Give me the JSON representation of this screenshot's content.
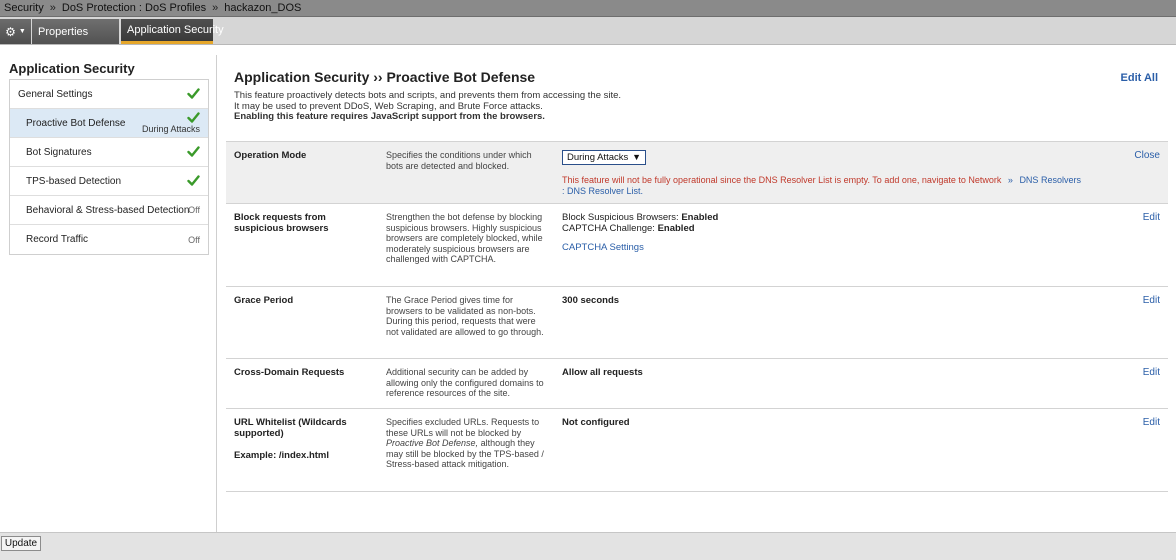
{
  "breadcrumb": {
    "items": [
      "Security",
      "DoS Protection : DoS Profiles",
      "hackazon_DOS"
    ],
    "separator": "»"
  },
  "tabs": {
    "gear_icon": "gear-icon",
    "properties": "Properties",
    "application_security": "Application Security"
  },
  "sidebar": {
    "title": "Application Security",
    "items": [
      {
        "label": "General Settings",
        "status": "",
        "check": true
      },
      {
        "label": "Proactive Bot Defense",
        "status": "During Attacks",
        "check": true
      },
      {
        "label": "Bot Signatures",
        "status": "",
        "check": true
      },
      {
        "label": "TPS-based Detection",
        "status": "",
        "check": true
      },
      {
        "label": "Behavioral & Stress-based Detection",
        "status": "Off",
        "check": false
      },
      {
        "label": "Record Traffic",
        "status": "Off",
        "check": false
      }
    ]
  },
  "main": {
    "title": "Application Security ›› Proactive Bot Defense",
    "edit_all": "Edit All",
    "description": {
      "line1": "This feature proactively detects bots and scripts, and prevents them from accessing the site.",
      "line2": "It may be used to prevent DDoS, Web Scraping, and Brute Force attacks.",
      "line3": "Enabling this feature requires JavaScript support from the browsers."
    },
    "rows": {
      "operation_mode": {
        "label": "Operation Mode",
        "help": "Specifies the conditions under which bots are detected and blocked.",
        "select_value": "During Attacks",
        "warning_text": "This feature will not be fully operational since the DNS Resolver List is empty. To add one, navigate to Network",
        "warning_sep": "»",
        "warning_link1": "DNS Resolvers",
        "warning_link2": ": DNS Resolver List.",
        "action": "Close"
      },
      "block_requests": {
        "label": "Block requests from suspicious browsers",
        "help": "Strengthen the bot defense by blocking suspicious browsers. Highly suspicious browsers are completely blocked, while moderately suspicious browsers are challenged with CAPTCHA.",
        "line1_label": "Block Suspicious Browsers:",
        "line1_value": "Enabled",
        "line2_label": "CAPTCHA Challenge:",
        "line2_value": "Enabled",
        "link": "CAPTCHA Settings",
        "action": "Edit"
      },
      "grace_period": {
        "label": "Grace Period",
        "help": "The Grace Period gives time for browsers to be validated as non-bots. During this period, requests that were not validated are allowed to go through.",
        "value": "300 seconds",
        "action": "Edit"
      },
      "cross_domain": {
        "label": "Cross-Domain Requests",
        "help": "Additional security can be added by allowing only the configured domains to reference resources of the site.",
        "value": "Allow all requests",
        "action": "Edit"
      },
      "url_whitelist": {
        "label": "URL Whitelist (Wildcards supported)",
        "example": "Example: /index.html",
        "help_pre": "Specifies excluded URLs. Requests to these URLs will not be blocked by",
        "help_italic": "Proactive Bot Defense,",
        "help_post": "although they may still be blocked by the TPS-based / Stress-based attack mitigation.",
        "value": "Not configured",
        "action": "Edit"
      }
    }
  },
  "footer": {
    "update_button": "Update"
  },
  "colors": {
    "link": "#2a5ea8",
    "warning": "#c0392b",
    "check": "#3a9a2a",
    "active_tab_underline": "#e6a72a",
    "selected_item": "#dce9f5"
  }
}
